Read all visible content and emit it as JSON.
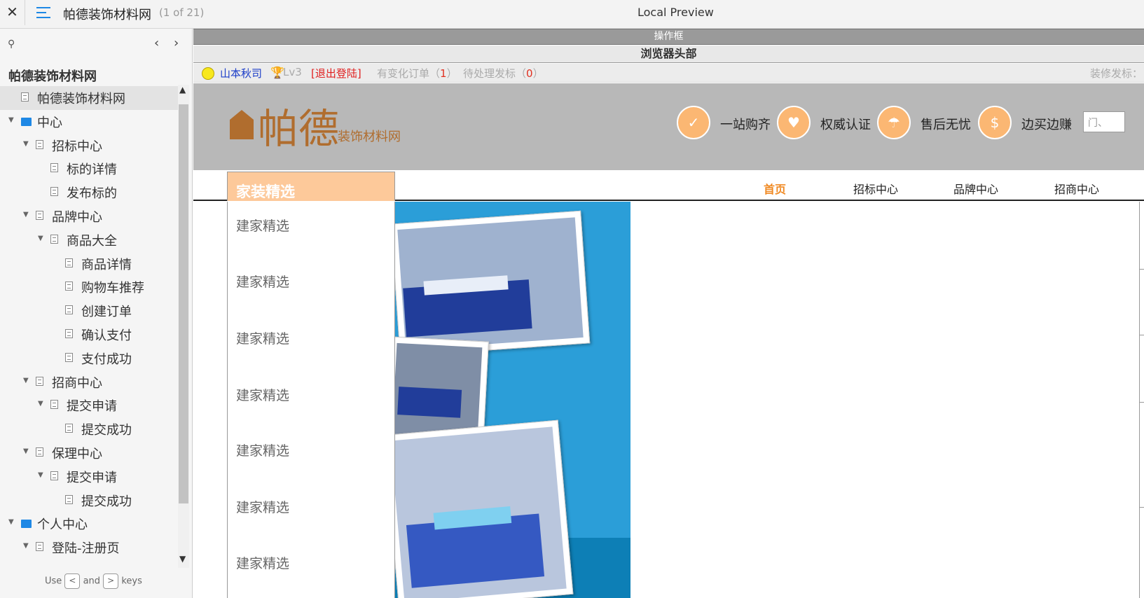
{
  "topbar": {
    "close_icon": "✕",
    "menu_icon": "hamburger-menu-icon",
    "project_title": "帕德装饰材料网",
    "page_count": "(1 of 21)",
    "preview_label": "Local Preview"
  },
  "sidebar": {
    "search_icon": "⚲",
    "prev_icon": "‹",
    "next_icon": "›",
    "heading": "帕德装饰材料网",
    "tree": [
      {
        "label": "帕德装饰材料网",
        "depth": 0,
        "type": "page",
        "expand": false,
        "selected": true
      },
      {
        "label": "中心",
        "depth": 0,
        "type": "folder",
        "expand": true
      },
      {
        "label": "招标中心",
        "depth": 1,
        "type": "page",
        "expand": true
      },
      {
        "label": "标的详情",
        "depth": 2,
        "type": "page",
        "expand": false
      },
      {
        "label": "发布标的",
        "depth": 2,
        "type": "page",
        "expand": false
      },
      {
        "label": "品牌中心",
        "depth": 1,
        "type": "page",
        "expand": true
      },
      {
        "label": "商品大全",
        "depth": 2,
        "type": "page",
        "expand": true
      },
      {
        "label": "商品详情",
        "depth": 3,
        "type": "page",
        "expand": false
      },
      {
        "label": "购物车推荐",
        "depth": 3,
        "type": "page",
        "expand": false
      },
      {
        "label": "创建订单",
        "depth": 3,
        "type": "page",
        "expand": false
      },
      {
        "label": "确认支付",
        "depth": 3,
        "type": "page",
        "expand": false
      },
      {
        "label": "支付成功",
        "depth": 3,
        "type": "page",
        "expand": false
      },
      {
        "label": "招商中心",
        "depth": 1,
        "type": "page",
        "expand": true
      },
      {
        "label": "提交申请",
        "depth": 2,
        "type": "page",
        "expand": true
      },
      {
        "label": "提交成功",
        "depth": 3,
        "type": "page",
        "expand": false
      },
      {
        "label": "保理中心",
        "depth": 1,
        "type": "page",
        "expand": true
      },
      {
        "label": "提交申请",
        "depth": 2,
        "type": "page",
        "expand": true
      },
      {
        "label": "提交成功",
        "depth": 3,
        "type": "page",
        "expand": false
      },
      {
        "label": "个人中心",
        "depth": 0,
        "type": "folder",
        "expand": true
      },
      {
        "label": "登陆-注册页",
        "depth": 1,
        "type": "page",
        "expand": true
      }
    ],
    "keys_hint": {
      "use": "Use",
      "key1": "<",
      "and": "and",
      "key2": ">",
      "keys": "keys"
    }
  },
  "preview": {
    "op_bar": "操作框",
    "browser_head": "浏览器头部",
    "user_bar": {
      "user_name": "山本秋司",
      "trophy_icon": "🏆",
      "level": "Lv3",
      "logout": "[退出登陆]",
      "changed_orders_label": "有变化订单（",
      "changed_orders_count": "1",
      "changed_orders_close": "）",
      "pending_bids_label": "待处理发标（",
      "pending_bids_count": "0",
      "pending_bids_close": "）",
      "reno_bid": "装修发标："
    },
    "logo": {
      "main": "帕德",
      "sub": "装饰材料网"
    },
    "features": [
      {
        "icon": "✓",
        "label": "一站购齐"
      },
      {
        "icon": "♥",
        "label": "权威认证"
      },
      {
        "icon": "☂",
        "label": "售后无忧"
      },
      {
        "icon": "$",
        "label": "边买边赚"
      }
    ],
    "search_placeholder": "门、",
    "category_tab": "家装精选",
    "nav_links": [
      "首页",
      "招标中心",
      "品牌中心",
      "招商中心"
    ],
    "active_nav": 0,
    "category_items": [
      "建家精选",
      "建家精选",
      "建家精选",
      "建家精选",
      "建家精选",
      "建家精选",
      "建家精选"
    ],
    "colors": {
      "accent": "#f08a24",
      "logo": "#b06d2e",
      "feature_circle": "#fbb773",
      "banner_bg": "#2b9ed8"
    }
  }
}
